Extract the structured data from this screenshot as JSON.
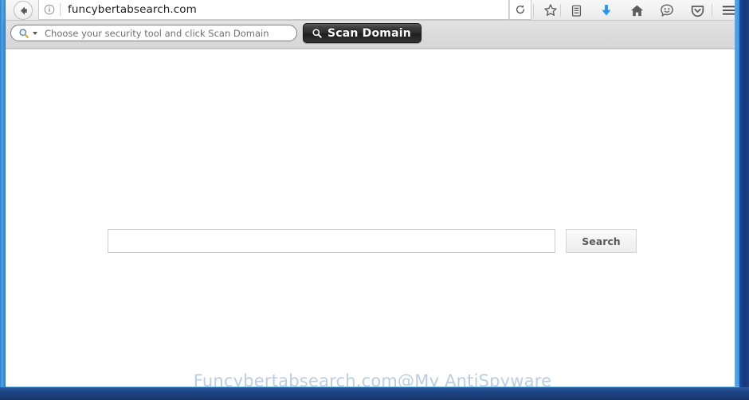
{
  "browser": {
    "url": "funcybertabsearch.com",
    "back_button": "Back",
    "identity_icon": "info-circle-icon",
    "reload_icon": "reload-icon",
    "toolbar_icons": [
      {
        "name": "bookmark-star-icon",
        "label": "Bookmark this page"
      },
      {
        "name": "library-icon",
        "label": "Library"
      },
      {
        "name": "downloads-icon",
        "label": "Downloads"
      },
      {
        "name": "home-icon",
        "label": "Home"
      },
      {
        "name": "smiley-face-icon",
        "label": "Feedback"
      },
      {
        "name": "pocket-shield-icon",
        "label": "Save to Pocket"
      },
      {
        "name": "hamburger-menu-icon",
        "label": "Open menu"
      }
    ],
    "colors": {
      "download_arrow": "#2196f3",
      "frame_dark_blue": "#1b4a9c",
      "frame_light_blue": "#4ea2e6"
    }
  },
  "scan_toolbar": {
    "field_placeholder": "Choose your security tool and click Scan Domain",
    "field_value": "",
    "dropdown_icon": "chevron-down-icon",
    "magnifier_icon": "magnifier-icon",
    "scan_button_label": "Scan Domain",
    "scan_button_icon": "magnifier-icon",
    "scan_button_color": "#2b2b2b"
  },
  "page": {
    "search_value": "",
    "search_placeholder": "",
    "search_button_label": "Search",
    "watermark": "Funcybertabsearch.com@My AntiSpyware"
  }
}
